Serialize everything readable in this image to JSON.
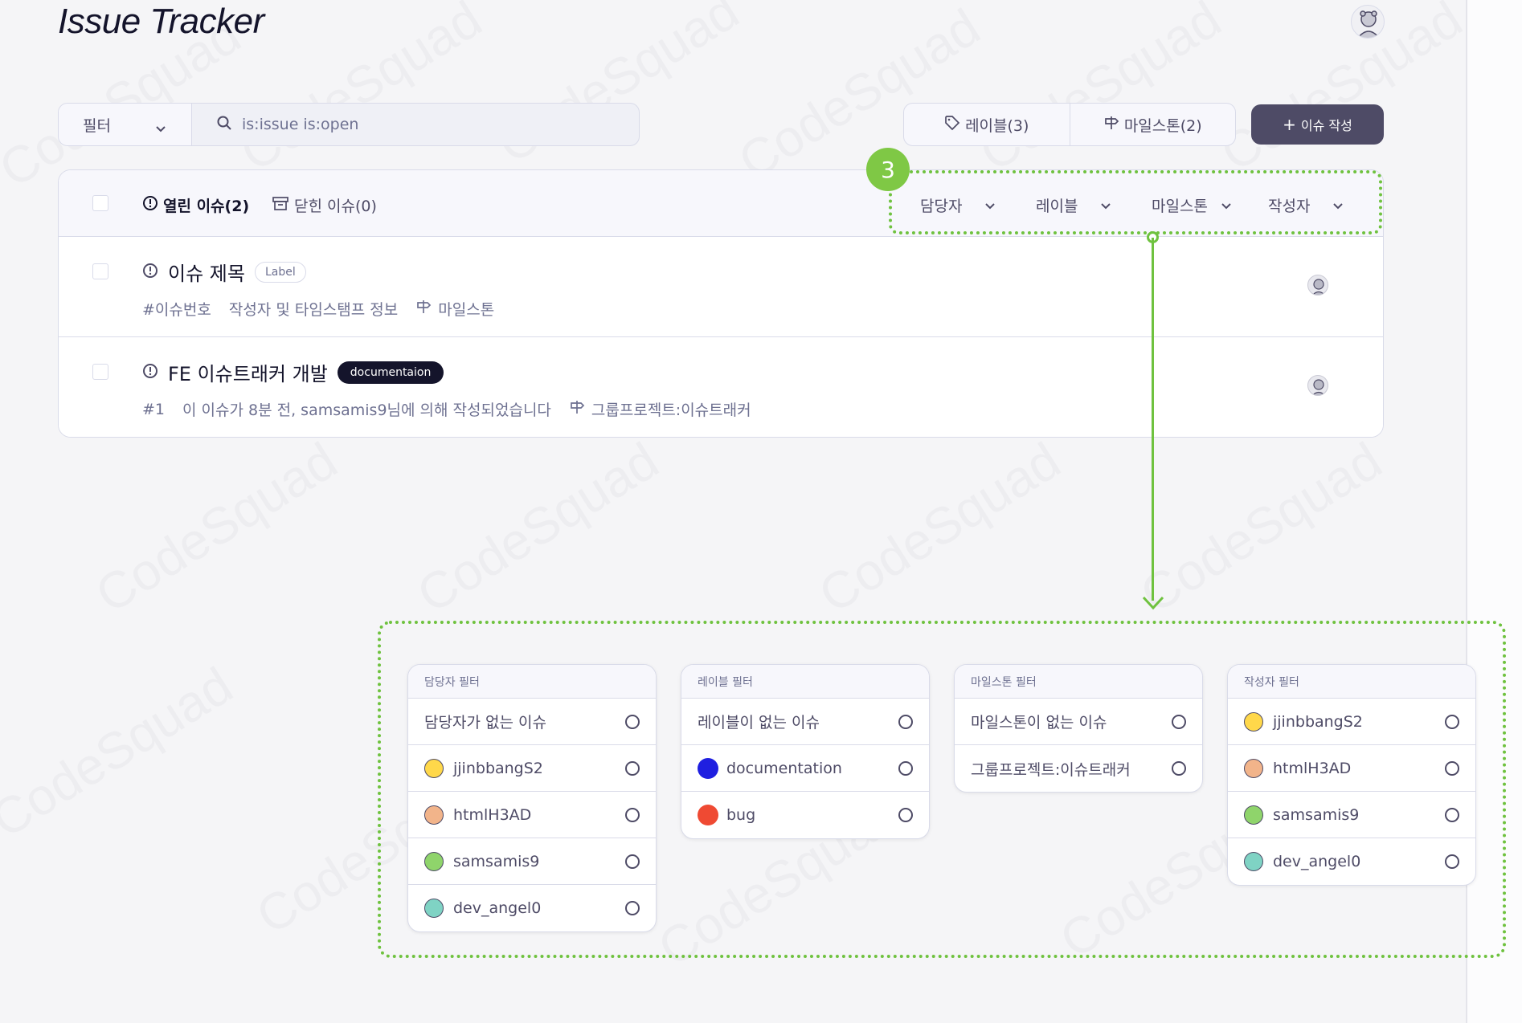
{
  "app": {
    "title": "Issue Tracker"
  },
  "toolbar": {
    "filter_label": "필터",
    "search_value": "is:issue is:open",
    "labels_tab": "레이블(3)",
    "milestones_tab": "마일스톤(2)",
    "new_issue": "이슈 작성"
  },
  "list_header": {
    "open_tab": "열린 이슈(2)",
    "closed_tab": "닫힌 이슈(0)",
    "filters": [
      "담당자",
      "레이블",
      "마일스톤",
      "작성자"
    ]
  },
  "issues": [
    {
      "title": "이슈 제목",
      "label": "Label",
      "number": "#이슈번호",
      "info": "작성자 및 타임스탬프 정보",
      "milestone": "마일스톤"
    },
    {
      "title": "FE 이슈트래커 개발",
      "label": "documentaion",
      "number": "#1",
      "info": "이 이슈가 8분 전, samsamis9님에 의해 작성되었습니다",
      "milestone": "그룹프로젝트:이슈트래커"
    }
  ],
  "annotation": {
    "step": "3"
  },
  "panels": {
    "assignee": {
      "title": "담당자 필터",
      "items": [
        "담당자가 없는 이슈",
        "jjinbbangS2",
        "htmlH3AD",
        "samsamis9",
        "dev_angel0"
      ]
    },
    "label": {
      "title": "레이블 필터",
      "items": [
        "레이블이 없는 이슈",
        "documentation",
        "bug"
      ]
    },
    "milestone": {
      "title": "마일스톤 필터",
      "items": [
        "마일스톤이 없는 이슈",
        "그룹프로젝트:이슈트래커"
      ]
    },
    "author": {
      "title": "작성자 필터",
      "items": [
        "jjinbbangS2",
        "htmlH3AD",
        "samsamis9",
        "dev_angel0"
      ]
    }
  },
  "colors": {
    "accent_green": "#6fc23f",
    "label_documentation": "#1f1fe0",
    "label_bug": "#ef4a33",
    "dark": "#14142b"
  }
}
